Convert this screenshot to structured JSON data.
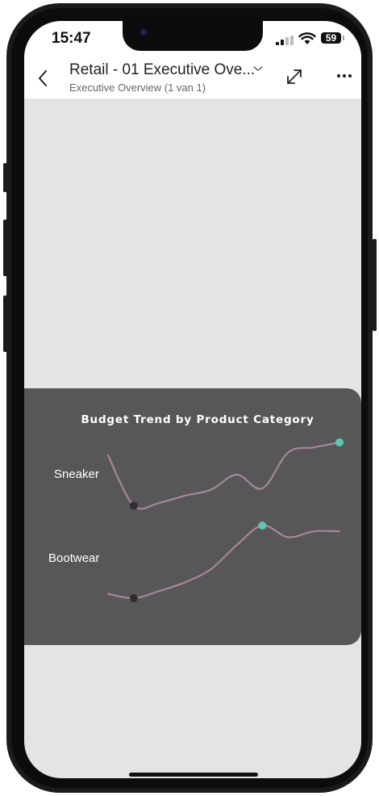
{
  "status_bar": {
    "time": "15:47",
    "battery_level": "59",
    "signal_icon": "cellular-signal-icon",
    "wifi_icon": "wifi-icon"
  },
  "header": {
    "title": "Retail - 01 Executive Ove...",
    "subtitle": "Executive Overview (1 van 1)",
    "back_icon": "chevron-left-icon",
    "dropdown_icon": "chevron-down-icon",
    "expand_icon": "expand-arrows-icon",
    "more_icon": "ellipsis-icon"
  },
  "colors": {
    "line": "#a7849f",
    "low_point": "#2f2f33",
    "high_point": "#5cc8b3",
    "card_bg": "#575757",
    "canvas_bg": "#e4e4e4"
  },
  "chart_data": {
    "type": "line",
    "title": "Budget Trend by Product Category",
    "series": [
      {
        "name": "Sneaker",
        "values": [
          0.82,
          0.12,
          0.16,
          0.26,
          0.34,
          0.55,
          0.36,
          0.86,
          0.93,
          1.0
        ]
      },
      {
        "name": "Bootwear",
        "values": [
          0.06,
          0.0,
          0.1,
          0.22,
          0.4,
          0.73,
          1.0,
          0.84,
          0.92,
          0.92
        ]
      }
    ],
    "markers": "lowest point dark, highest point teal",
    "note": "values normalized 0-1 per series; no axes shown"
  }
}
